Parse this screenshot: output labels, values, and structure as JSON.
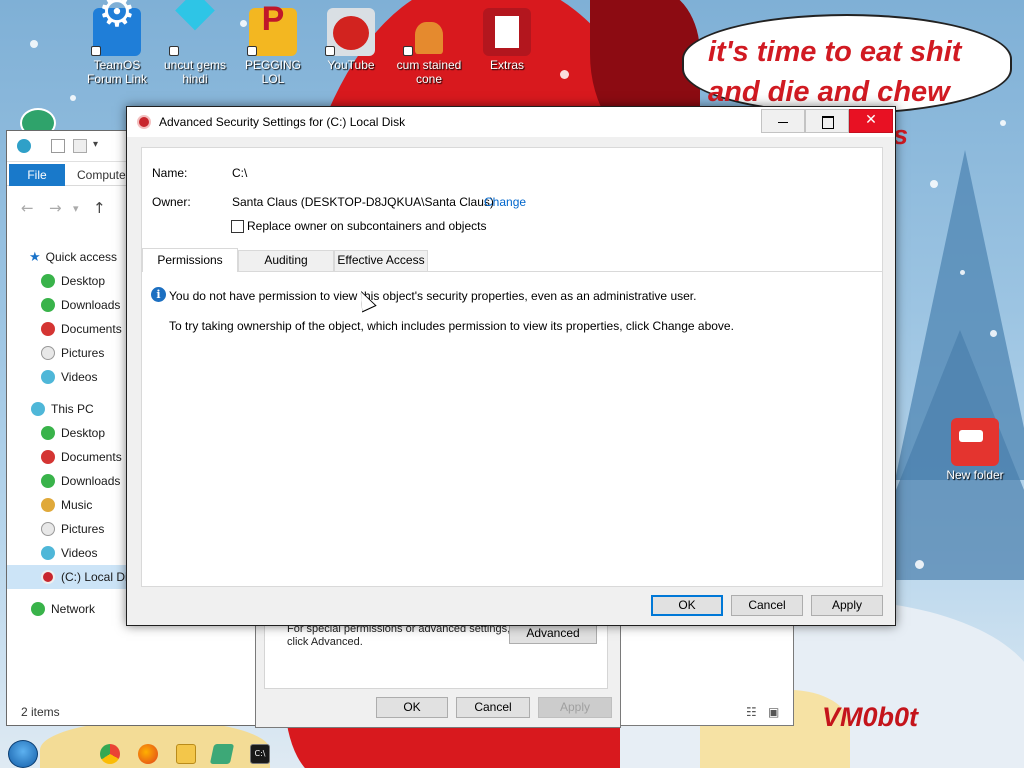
{
  "desktop": {
    "icons": [
      {
        "label": "TeamOS Forum Link",
        "icon": "gear-icon"
      },
      {
        "label": "uncut gems hindi",
        "icon": "diamond-icon"
      },
      {
        "label": "PEGGING LOL",
        "icon": "p-logo-icon"
      },
      {
        "label": "YouTube",
        "icon": "angry-bird-icon"
      },
      {
        "label": "cum stained cone",
        "icon": "traffic-cone-icon"
      },
      {
        "label": "Extras",
        "icon": "folder-icon"
      },
      {
        "label": "New folder",
        "icon": "folder-icon"
      }
    ],
    "speech_text": "it's time to eat shit and die and chew",
    "speech_tail": "s",
    "signature": "VM0b0t"
  },
  "explorer": {
    "ribbon": {
      "file": "File",
      "computer": "Compute"
    },
    "nav": {
      "quick_access": "Quick access",
      "quick_items": [
        "Desktop",
        "Downloads",
        "Documents",
        "Pictures",
        "Videos"
      ],
      "this_pc": "This PC",
      "pc_items": [
        "Desktop",
        "Documents",
        "Downloads",
        "Music",
        "Pictures",
        "Videos"
      ],
      "selected_drive": "(C:) Local Di",
      "network": "Network"
    },
    "status": "2 items"
  },
  "properties": {
    "advanced_text": "For special permissions or advanced settings, click Advanced.",
    "advanced_button": "Advanced",
    "ok": "OK",
    "cancel": "Cancel",
    "apply": "Apply"
  },
  "dialog": {
    "title": "Advanced Security Settings for (C:) Local Disk",
    "name_label": "Name:",
    "name_value": "C:\\",
    "owner_label": "Owner:",
    "owner_value": "Santa Claus (DESKTOP-D8JQKUA\\Santa Claus)",
    "change_link": "Change",
    "replace_owner": "Replace owner on subcontainers and objects",
    "replace_owner_checked": false,
    "tabs": [
      "Permissions",
      "Auditing",
      "Effective Access"
    ],
    "active_tab": "Permissions",
    "info_message": "You do not have permission to view this object's security properties, even as an administrative user.",
    "hint_message": "To try taking ownership of the object, which includes permission to view its properties, click Change above.",
    "buttons": {
      "ok": "OK",
      "cancel": "Cancel",
      "apply": "Apply"
    }
  },
  "colors": {
    "accent": "#0078d7",
    "close_button": "#e81123",
    "link": "#0066cc",
    "wallpaper_red": "#d8191e"
  }
}
